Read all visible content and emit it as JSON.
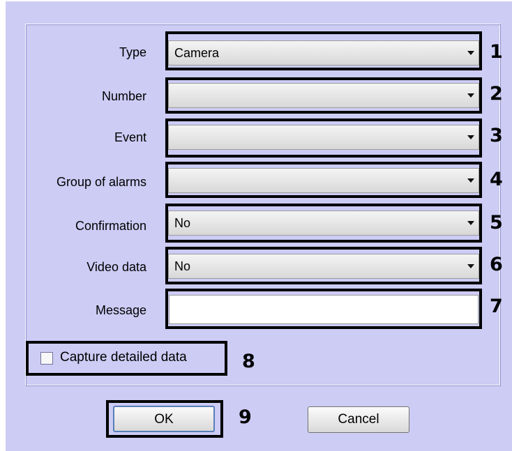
{
  "fields": {
    "type_label": "Type",
    "type_value": "Camera",
    "number_label": "Number",
    "number_value": "",
    "event_label": "Event",
    "event_value": "",
    "group_label": "Group of alarms",
    "group_value": "",
    "confirmation_label": "Confirmation",
    "confirmation_value": "No",
    "video_label": "Video data",
    "video_value": "No",
    "message_label": "Message",
    "message_value": ""
  },
  "checkbox": {
    "label": "Capture detailed data",
    "checked": false
  },
  "buttons": {
    "ok": "OK",
    "cancel": "Cancel"
  },
  "callouts": [
    "1",
    "2",
    "3",
    "4",
    "5",
    "6",
    "7",
    "8",
    "9"
  ]
}
